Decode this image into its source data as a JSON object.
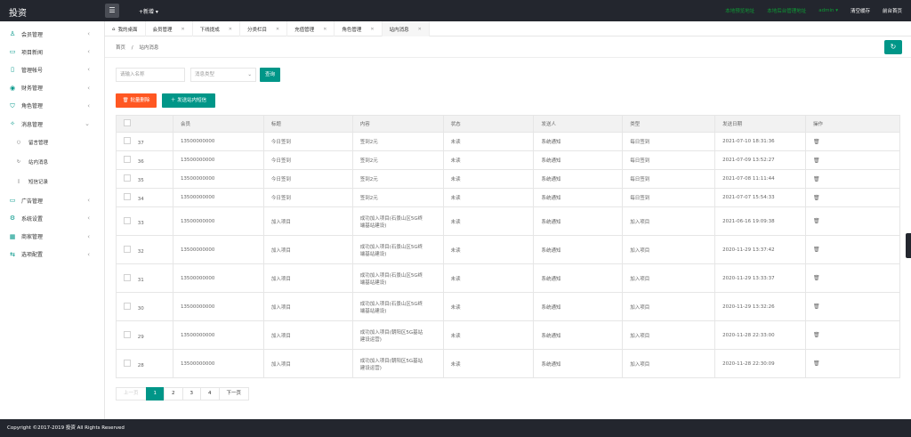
{
  "topbar": {
    "logo": "投资",
    "menu_toggle_icon": "menu-icon",
    "add_new": "+新增 ▾",
    "links": [
      {
        "label": "本地预览地址",
        "color": "#0e9b35"
      },
      {
        "label": "本地后台管理地址",
        "color": "#0e9b35"
      },
      {
        "label": "admin ▾",
        "color": "#0e9b35"
      },
      {
        "label": "清空缓存",
        "color": "#ffffff"
      },
      {
        "label": "前台首页",
        "color": "#ffffff"
      }
    ]
  },
  "sidebar": {
    "items": [
      {
        "label": "会员管理",
        "icon": "user-icon"
      },
      {
        "label": "项目新闻",
        "icon": "news-icon"
      },
      {
        "label": "管理帐号",
        "icon": "account-icon"
      },
      {
        "label": "财务管理",
        "icon": "finance-icon"
      },
      {
        "label": "角色管理",
        "icon": "role-icon"
      },
      {
        "label": "消息管理",
        "icon": "message-icon",
        "expanded": true
      }
    ],
    "sub_items": [
      {
        "label": "留言管理",
        "icon": "comment-icon"
      },
      {
        "label": "站内消息",
        "icon": "refresh-icon"
      },
      {
        "label": "短信记录",
        "icon": "sms-icon"
      }
    ],
    "items_after": [
      {
        "label": "广告管理",
        "icon": "ad-icon"
      },
      {
        "label": "系统设置",
        "icon": "gear-icon"
      },
      {
        "label": "商家管理",
        "icon": "merchant-icon"
      },
      {
        "label": "选项配置",
        "icon": "option-icon"
      }
    ]
  },
  "tabs": [
    {
      "label": "我的桌面",
      "home": true
    },
    {
      "label": "会员管理"
    },
    {
      "label": "下线提成"
    },
    {
      "label": "分类栏目"
    },
    {
      "label": "充值管理"
    },
    {
      "label": "角色管理"
    },
    {
      "label": "站内消息",
      "active": true
    }
  ],
  "breadcrumb": {
    "home": "首页",
    "sep": "/",
    "current": "站内消息"
  },
  "search": {
    "placeholder": "请输入名称",
    "select_placeholder": "消息类型",
    "query_label": "查询"
  },
  "actions": {
    "delete_label": "批量删除",
    "send_label": "发送站内短信"
  },
  "table": {
    "headers": [
      "会员",
      "标题",
      "内容",
      "状态",
      "发送人",
      "类型",
      "发送日期",
      "操作"
    ],
    "rows": [
      {
        "id": "37",
        "member": "13500000000",
        "title": "今日签到",
        "content": "签到2元",
        "status": "未读",
        "sender": "系统通知",
        "type": "每日签到",
        "date": "2021-07-10 18:31:36"
      },
      {
        "id": "36",
        "member": "13500000000",
        "title": "今日签到",
        "content": "签到2元",
        "status": "未读",
        "sender": "系统通知",
        "type": "每日签到",
        "date": "2021-07-09 13:52:27"
      },
      {
        "id": "35",
        "member": "13500000000",
        "title": "今日签到",
        "content": "签到2元",
        "status": "未读",
        "sender": "系统通知",
        "type": "每日签到",
        "date": "2021-07-08 11:11:44"
      },
      {
        "id": "34",
        "member": "13500000000",
        "title": "今日签到",
        "content": "签到2元",
        "status": "未读",
        "sender": "系统通知",
        "type": "每日签到",
        "date": "2021-07-07 15:54:33"
      },
      {
        "id": "33",
        "member": "13500000000",
        "title": "加入项目",
        "content_lines": [
          "成功加入项目(石景山区5G终",
          "端基站建设)"
        ],
        "status": "未读",
        "sender": "系统通知",
        "type": "加入项目",
        "date": "2021-06-16 19:09:38"
      },
      {
        "id": "32",
        "member": "13500000000",
        "title": "加入项目",
        "content_lines": [
          "成功加入项目(石景山区5G终",
          "端基站建设)"
        ],
        "status": "未读",
        "sender": "系统通知",
        "type": "加入项目",
        "date": "2020-11-29 13:37:42"
      },
      {
        "id": "31",
        "member": "13500000000",
        "title": "加入项目",
        "content_lines": [
          "成功加入项目(石景山区5G终",
          "端基站建设)"
        ],
        "status": "未读",
        "sender": "系统通知",
        "type": "加入项目",
        "date": "2020-11-29 13:33:37"
      },
      {
        "id": "30",
        "member": "13500000000",
        "title": "加入项目",
        "content_lines": [
          "成功加入项目(石景山区5G终",
          "端基站建设)"
        ],
        "status": "未读",
        "sender": "系统通知",
        "type": "加入项目",
        "date": "2020-11-29 13:32:26"
      },
      {
        "id": "29",
        "member": "13500000000",
        "title": "加入项目",
        "content_lines": [
          "成功加入项目(朝阳区5G基站",
          "建设运营)"
        ],
        "status": "未读",
        "sender": "系统通知",
        "type": "加入项目",
        "date": "2020-11-28 22:33:00"
      },
      {
        "id": "28",
        "member": "13500000000",
        "title": "加入项目",
        "content_lines": [
          "成功加入项目(朝阳区5G基站",
          "建设运营)"
        ],
        "status": "未读",
        "sender": "系统通知",
        "type": "加入项目",
        "date": "2020-11-28 22:30:09"
      }
    ]
  },
  "pager": {
    "prev": "上一页",
    "pages": [
      "1",
      "2",
      "3",
      "4"
    ],
    "current": "1",
    "next": "下一页"
  },
  "footer": {
    "text": "Copyright ©2017-2019 投资 All Rights Reserved"
  },
  "colors": {
    "accent": "#009688",
    "danger": "#ff5722",
    "topbar": "#23262e",
    "top_link_green": "#0e9b35"
  }
}
